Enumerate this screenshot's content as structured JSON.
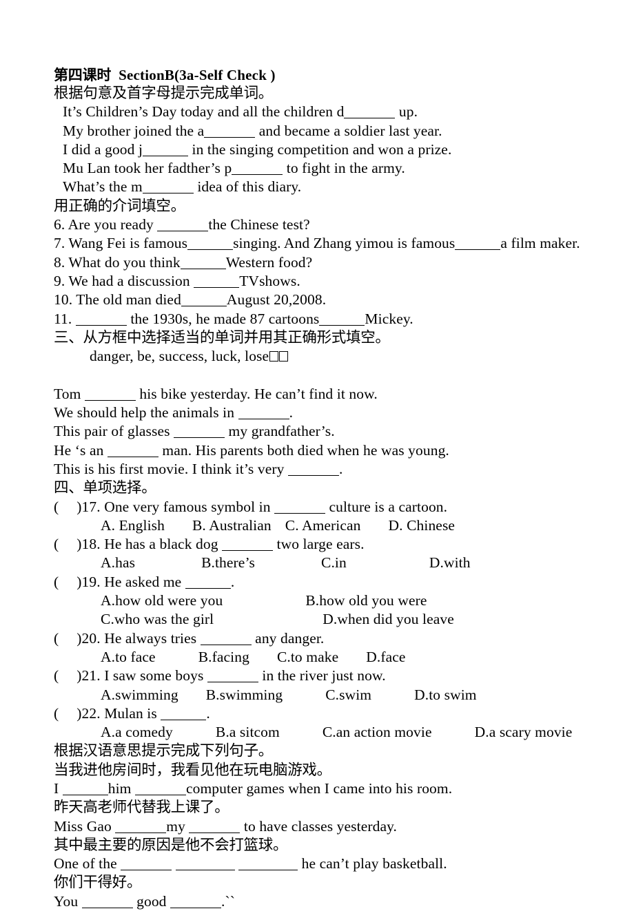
{
  "document": {
    "title_cn": "第四课时",
    "title_en": "SectionB(3a-Self Check )",
    "section1": {
      "heading": "根据句意及首字母提示完成单词。",
      "items": [
        {
          "pre": "It’s Children’s Day today and all the children d",
          "post": " up."
        },
        {
          "pre": "My brother joined the a",
          "post": " and became a soldier last year."
        },
        {
          "pre": "I did a good j",
          "post": " in the singing competition and won a prize."
        },
        {
          "pre": "Mu Lan took her fadther’s p",
          "post": " to fight in the army."
        },
        {
          "pre": "What’s the m",
          "post": " idea of this diary."
        }
      ]
    },
    "section2": {
      "heading": "用正确的介词填空。",
      "q6_pre": "6. Are you ready ",
      "q6_post": "the Chinese test?",
      "q7_a": "7. Wang Fei is famous",
      "q7_b": "singing. And Zhang yimou is famous",
      "q7_c": "a film maker.",
      "q8_pre": "8. What do you think",
      "q8_post": "Western food?",
      "q9_pre": "9. We had a discussion ",
      "q9_post": "TVshows.",
      "q10_pre": "10. The old man died",
      "q10_post": "August 20,2008.",
      "q11_a": "11. ",
      "q11_b": " the 1930s, he made 87 cartoons",
      "q11_c": "Mickey."
    },
    "section3": {
      "heading": "三、从方框中选择适当的单词并用其正确形式填空。",
      "wordbox": "danger, be, success, luck, lose",
      "items": [
        {
          "pre": "Tom ",
          "post": " his bike yesterday. He can’t find it now."
        },
        {
          "pre": "We should help the animals in ",
          "post": "."
        },
        {
          "pre": "This pair of glasses ",
          "post": " my grandfather’s."
        },
        {
          "pre": "He ‘s an ",
          "post": " man. His parents both died when he was young."
        },
        {
          "pre": "This is his first movie. I think it’s very ",
          "post": "."
        }
      ]
    },
    "section4": {
      "heading": "四、单项选择。",
      "questions": [
        {
          "num": ")17. ",
          "pre": "One very famous symbol in ",
          "post": " culture is a cartoon.",
          "options": [
            "A. English",
            "B. Australian",
            "C. American",
            "D. Chinese"
          ]
        },
        {
          "num": ")18. ",
          "pre": "He has a black dog ",
          "post": " two large ears.",
          "options": [
            "A.has",
            "B.there’s",
            "C.in",
            "D.with"
          ]
        },
        {
          "num": ")19. ",
          "pre": "He asked me ",
          "post": ".",
          "options": [
            "A.how old were you",
            "B.how old you were",
            "C.who was the girl",
            "D.when did you leave"
          ]
        },
        {
          "num": ")20. ",
          "pre": "He always tries ",
          "post": " any danger.",
          "options": [
            "A.to face",
            "B.facing",
            "C.to make",
            "D.face"
          ]
        },
        {
          "num": ")21. ",
          "pre": "I saw some boys ",
          "post": " in the river just now.",
          "options": [
            "A.swimming",
            "B.swimming",
            "C.swim",
            "D.to swim"
          ]
        },
        {
          "num": ")22. ",
          "pre": "Mulan is ",
          "post": ".",
          "options": [
            "A.a comedy",
            "B.a sitcom",
            "C.an action movie",
            "D.a scary movie"
          ]
        }
      ],
      "open_paren": "("
    },
    "section5": {
      "heading": "根据汉语意思提示完成下列句子。",
      "pairs": [
        {
          "cn": "当我进他房间时，我看见他在玩电脑游戏。",
          "en_a": "I ",
          "en_b": "him ",
          "en_c": "computer games when I came into his room."
        },
        {
          "cn": "昨天高老师代替我上课了。",
          "en_a": "Miss Gao ",
          "en_b": "my ",
          "en_c": " to have classes yesterday."
        },
        {
          "cn": "其中最主要的原因是他不会打篮球。",
          "en_a": "One of the ",
          "en_b": " ",
          "en_c": " ",
          "en_d": " he can’t play basketball."
        },
        {
          "cn": "你们干得好。",
          "en_a": "You ",
          "en_b": " good ",
          "en_c": ".``"
        }
      ]
    }
  }
}
